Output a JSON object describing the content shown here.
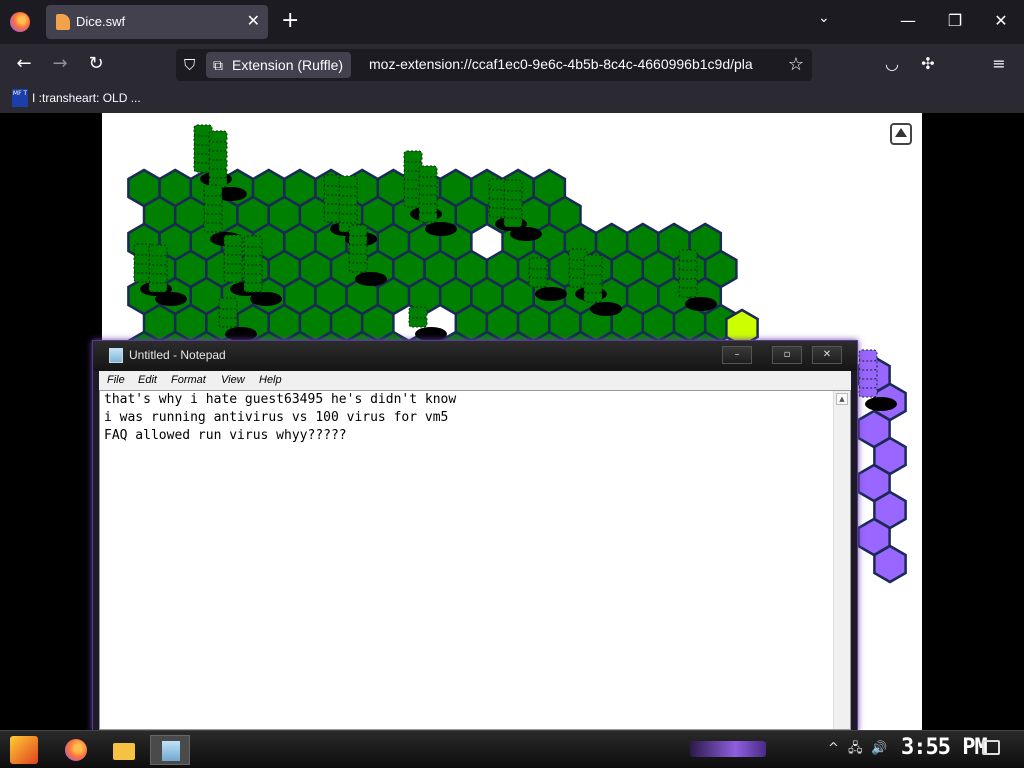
{
  "browser": {
    "tab": {
      "title": "Dice.swf",
      "close": "✕"
    },
    "new_tab": "+",
    "tab_list": "⌄",
    "window_controls": {
      "minimize": "—",
      "maximize": "❐",
      "close": "✕"
    },
    "nav": {
      "back": "←",
      "forward": "→",
      "reload": "↻",
      "shield": "⛉",
      "star": "☆"
    },
    "extension_chip": "Extension (Ruffle)",
    "url": "moz-extension://ccaf1ec0-9e6c-4b5b-8c4c-4660996b1c9d/pla",
    "tools": {
      "pocket": "◡",
      "extensions": "✣",
      "menu": "≡"
    },
    "bookmark": {
      "icon_text": "MF T",
      "label": "I :transheart: OLD ..."
    }
  },
  "game": {
    "colors": {
      "green": "#008000",
      "purple": "#9966ff",
      "lime": "#ccff00",
      "outline": "#1a2a55"
    }
  },
  "notepad": {
    "title": "Untitled - Notepad",
    "controls": {
      "minimize": "–",
      "maximize": "▫",
      "close": "✕"
    },
    "menu": [
      "File",
      "Edit",
      "Format",
      "View",
      "Help"
    ],
    "text": "that's why i hate guest63495 he's didn't know\ni was running antivirus vs 100 virus for vm5\nFAQ allowed run virus whyy?????"
  },
  "taskbar": {
    "clock": "3:55 PM",
    "tray": {
      "chevron": "^",
      "network": "🖧",
      "volume": "🔊"
    }
  }
}
